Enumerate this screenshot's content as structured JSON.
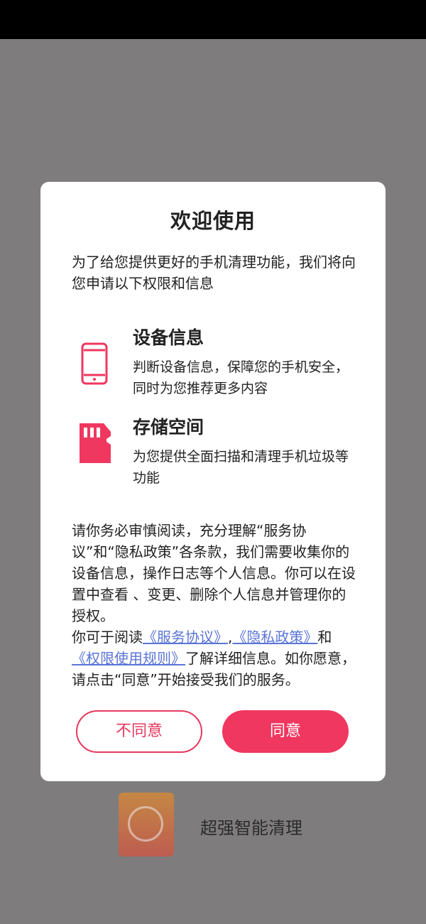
{
  "dialog": {
    "title": "欢迎使用",
    "intro": "为了给您提供更好的手机清理功能，我们将向您申请以下权限和信息",
    "permissions": [
      {
        "icon": "phone-icon",
        "title": "设备信息",
        "desc": "判断设备信息，保障您的手机安全，同时为您推荐更多内容"
      },
      {
        "icon": "sd-card-icon",
        "title": "存储空间",
        "desc": "为您提供全面扫描和清理手机垃圾等功能"
      }
    ],
    "notice": {
      "p1": "请你务必审慎阅读，充分理解“服务协议”和“隐私政策”各条款，我们需要收集你的设备信息，操作日志等个人信息。你可以在设置中查看 、变更、删除个人信息并管理你的授权。",
      "p2_prefix": "你可于阅读",
      "link_service": "《服务协议》",
      "comma": ",",
      "link_privacy": "《隐私政策》",
      "and": "和",
      "link_permission": "《权限使用规则》",
      "p2_suffix": "了解详细信息。如你愿意，请点击“同意”开始接受我们的服务。"
    },
    "disagree_label": "不同意",
    "agree_label": "同意"
  },
  "background": {
    "app_name": "超强智能清理"
  },
  "colors": {
    "accent": "#f0375f",
    "link": "#5a75d6",
    "overlay": "#7e7c7d"
  }
}
